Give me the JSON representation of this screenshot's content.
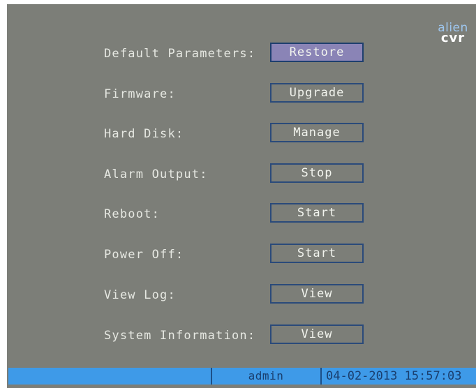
{
  "logo": {
    "line1": "alien",
    "line2": "cvr"
  },
  "rows": [
    {
      "label": "Default Parameters:",
      "button": "Restore",
      "selected": true
    },
    {
      "label": "Firmware:",
      "button": "Upgrade"
    },
    {
      "label": "Hard Disk:",
      "button": "Manage"
    },
    {
      "label": "Alarm Output:",
      "button": "Stop"
    },
    {
      "label": "Reboot:",
      "button": "Start"
    },
    {
      "label": "Power Off:",
      "button": "Start"
    },
    {
      "label": "View Log:",
      "button": "View"
    },
    {
      "label": "System Information:",
      "button": "View"
    }
  ],
  "status": {
    "user": "admin",
    "datetime": "04-02-2013 15:57:03"
  },
  "colors": {
    "background": "#7c7e78",
    "selected_button": "#8a84b6",
    "status_bar": "#3e9ae8"
  }
}
